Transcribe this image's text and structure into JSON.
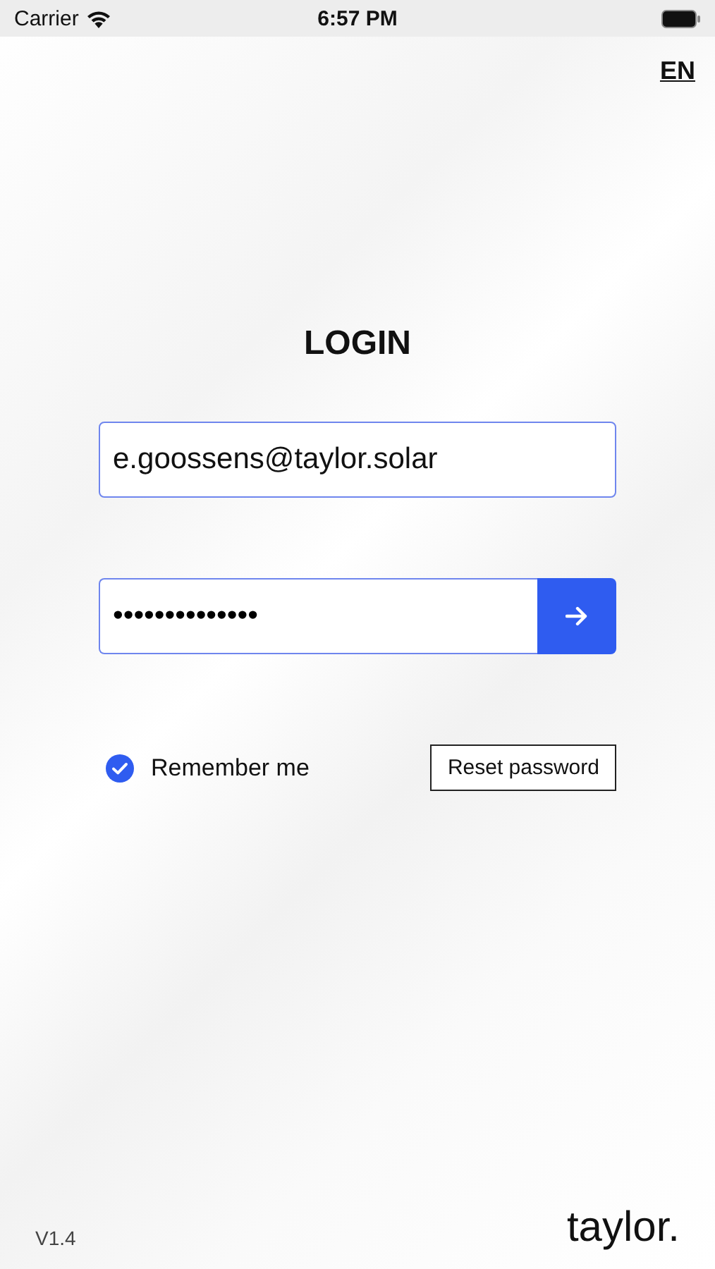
{
  "status_bar": {
    "carrier": "Carrier",
    "time": "6:57 PM"
  },
  "language": "EN",
  "title": "LOGIN",
  "email": {
    "value": "e.goossens@taylor.solar"
  },
  "password": {
    "value": "••••••••••••••"
  },
  "remember": {
    "label": "Remember me",
    "checked": true
  },
  "reset_button": "Reset password",
  "version": "V1.4",
  "logo": "taylor."
}
